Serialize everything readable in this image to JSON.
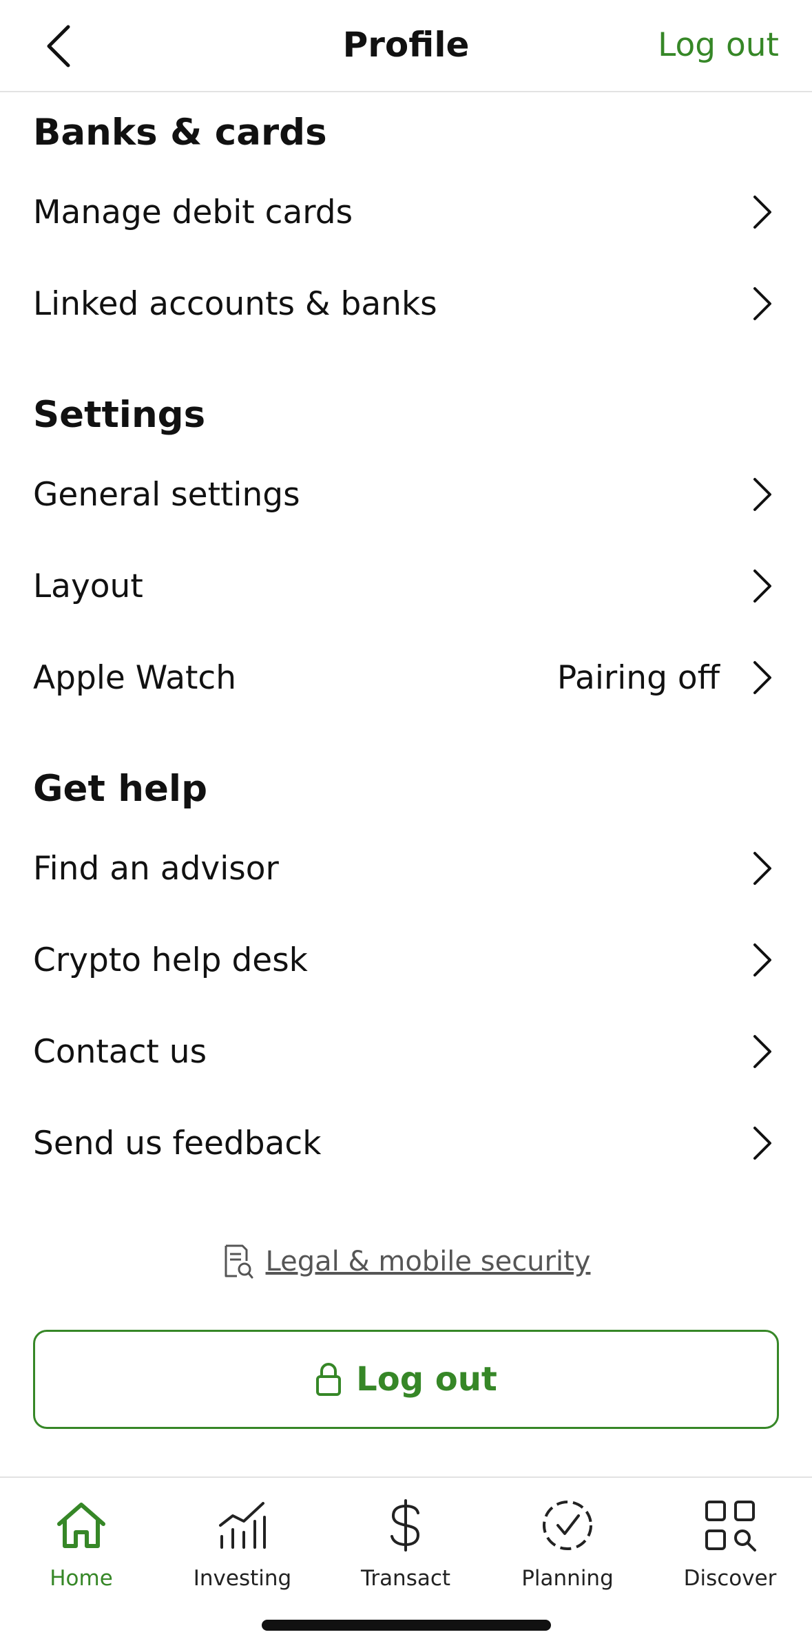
{
  "header": {
    "title": "Profile",
    "logout_link": "Log out",
    "back_icon": "chevron-left-icon"
  },
  "sections": {
    "banks": {
      "title": "Banks & cards",
      "items": [
        {
          "label": "Manage debit cards"
        },
        {
          "label": "Linked accounts & banks"
        }
      ]
    },
    "settings": {
      "title": "Settings",
      "items": [
        {
          "label": "General settings"
        },
        {
          "label": "Layout"
        },
        {
          "label": "Apple Watch",
          "value": "Pairing off"
        }
      ]
    },
    "help": {
      "title": "Get help",
      "items": [
        {
          "label": "Find an advisor"
        },
        {
          "label": "Crypto help desk"
        },
        {
          "label": "Contact us"
        },
        {
          "label": "Send us feedback"
        }
      ]
    }
  },
  "legal": {
    "label": "Legal & mobile security",
    "icon": "document-search-icon"
  },
  "logout_button": {
    "label": "Log out",
    "icon": "lock-icon"
  },
  "bottom_nav": {
    "items": [
      {
        "label": "Home",
        "icon": "home-icon",
        "active": true
      },
      {
        "label": "Investing",
        "icon": "investing-chart-icon",
        "active": false
      },
      {
        "label": "Transact",
        "icon": "dollar-icon",
        "active": false
      },
      {
        "label": "Planning",
        "icon": "planning-check-icon",
        "active": false
      },
      {
        "label": "Discover",
        "icon": "discover-grid-icon",
        "active": false
      }
    ]
  },
  "colors": {
    "accent": "#368727",
    "text": "#111111",
    "divider": "#e2e2e2"
  }
}
